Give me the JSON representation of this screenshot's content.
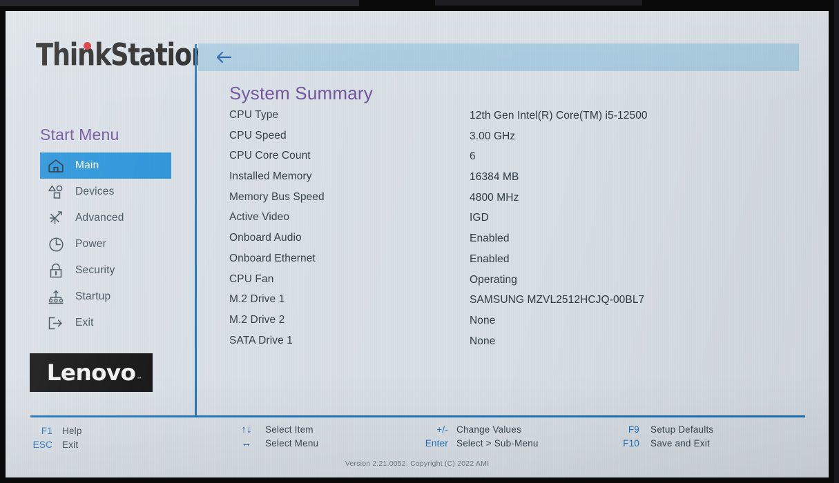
{
  "brand": {
    "product_logo": "ThinkStation",
    "vendor_logo": "Lenovo",
    "vendor_tm": "™"
  },
  "sidebar": {
    "heading": "Start Menu",
    "items": [
      {
        "label": "Main",
        "icon": "home-icon",
        "active": true
      },
      {
        "label": "Devices",
        "icon": "devices-icon",
        "active": false
      },
      {
        "label": "Advanced",
        "icon": "advanced-icon",
        "active": false
      },
      {
        "label": "Power",
        "icon": "power-clock-icon",
        "active": false
      },
      {
        "label": "Security",
        "icon": "lock-icon",
        "active": false
      },
      {
        "label": "Startup",
        "icon": "startup-network-icon",
        "active": false
      },
      {
        "label": "Exit",
        "icon": "exit-arrow-icon",
        "active": false
      }
    ]
  },
  "header": {
    "back_icon": "back-arrow-icon"
  },
  "main": {
    "title": "System Summary",
    "rows": [
      {
        "label": "CPU Type",
        "value": "12th Gen Intel(R) Core(TM) i5-12500"
      },
      {
        "label": "CPU Speed",
        "value": "3.00 GHz"
      },
      {
        "label": "CPU Core Count",
        "value": "6"
      },
      {
        "label": "Installed Memory",
        "value": "16384 MB"
      },
      {
        "label": "Memory Bus Speed",
        "value": "4800 MHz"
      },
      {
        "label": "Active Video",
        "value": "IGD"
      },
      {
        "label": "Onboard Audio",
        "value": "Enabled"
      },
      {
        "label": "Onboard Ethernet",
        "value": "Enabled"
      },
      {
        "label": "CPU Fan",
        "value": "Operating"
      },
      {
        "label": "M.2 Drive 1",
        "value": "SAMSUNG MZVL2512HCJQ-00BL7"
      },
      {
        "label": "M.2 Drive 2",
        "value": "None"
      },
      {
        "label": "SATA Drive 1",
        "value": "None"
      }
    ]
  },
  "footer": {
    "group1": [
      {
        "key": "F1",
        "text": "Help"
      },
      {
        "key": "ESC",
        "text": "Exit"
      }
    ],
    "group2": [
      {
        "key": "↑↓",
        "text": "Select Item"
      },
      {
        "key": "↔",
        "text": "Select Menu"
      }
    ],
    "group3": [
      {
        "key": "+/-",
        "text": "Change Values"
      },
      {
        "key": "Enter",
        "text": "Select > Sub-Menu"
      }
    ],
    "group4": [
      {
        "key": "F9",
        "text": "Setup Defaults"
      },
      {
        "key": "F10",
        "text": "Save and Exit"
      }
    ],
    "version": "Version 2.21.0052. Copyright (C) 2022 AMI"
  },
  "colors": {
    "screen_bg": "#d7dee4",
    "accent_blue": "#1f8fd8",
    "divider_blue": "#1c72b8",
    "header_bar": "#a6c9de",
    "title_purple": "#6b4c9a",
    "key_blue": "#1f74bd",
    "brand_red": "#d8232a"
  }
}
